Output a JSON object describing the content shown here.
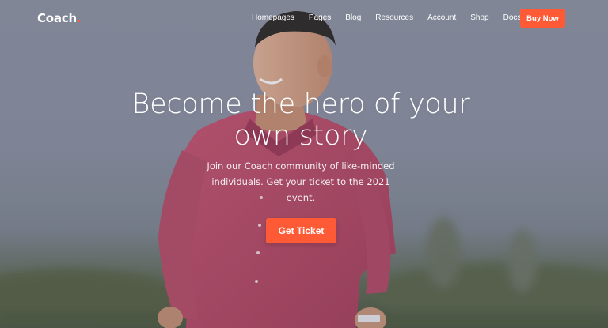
{
  "brand": {
    "name": "Coach",
    "dot": "."
  },
  "nav": {
    "items": [
      "Homepages",
      "Pages",
      "Blog",
      "Resources",
      "Account",
      "Shop",
      "Docs"
    ],
    "cta_label": "Buy Now"
  },
  "hero": {
    "headline": "Become the hero of your own story",
    "subtext": "Join our Coach community of like-minded individuals. Get your ticket to the 2021 event.",
    "cta_label": "Get Ticket"
  },
  "colors": {
    "accent": "#ff5a36",
    "shirt": "#c04a66",
    "sky": "#8b91a1"
  },
  "icons": {
    "background": "hero-photo-man-smiling"
  }
}
